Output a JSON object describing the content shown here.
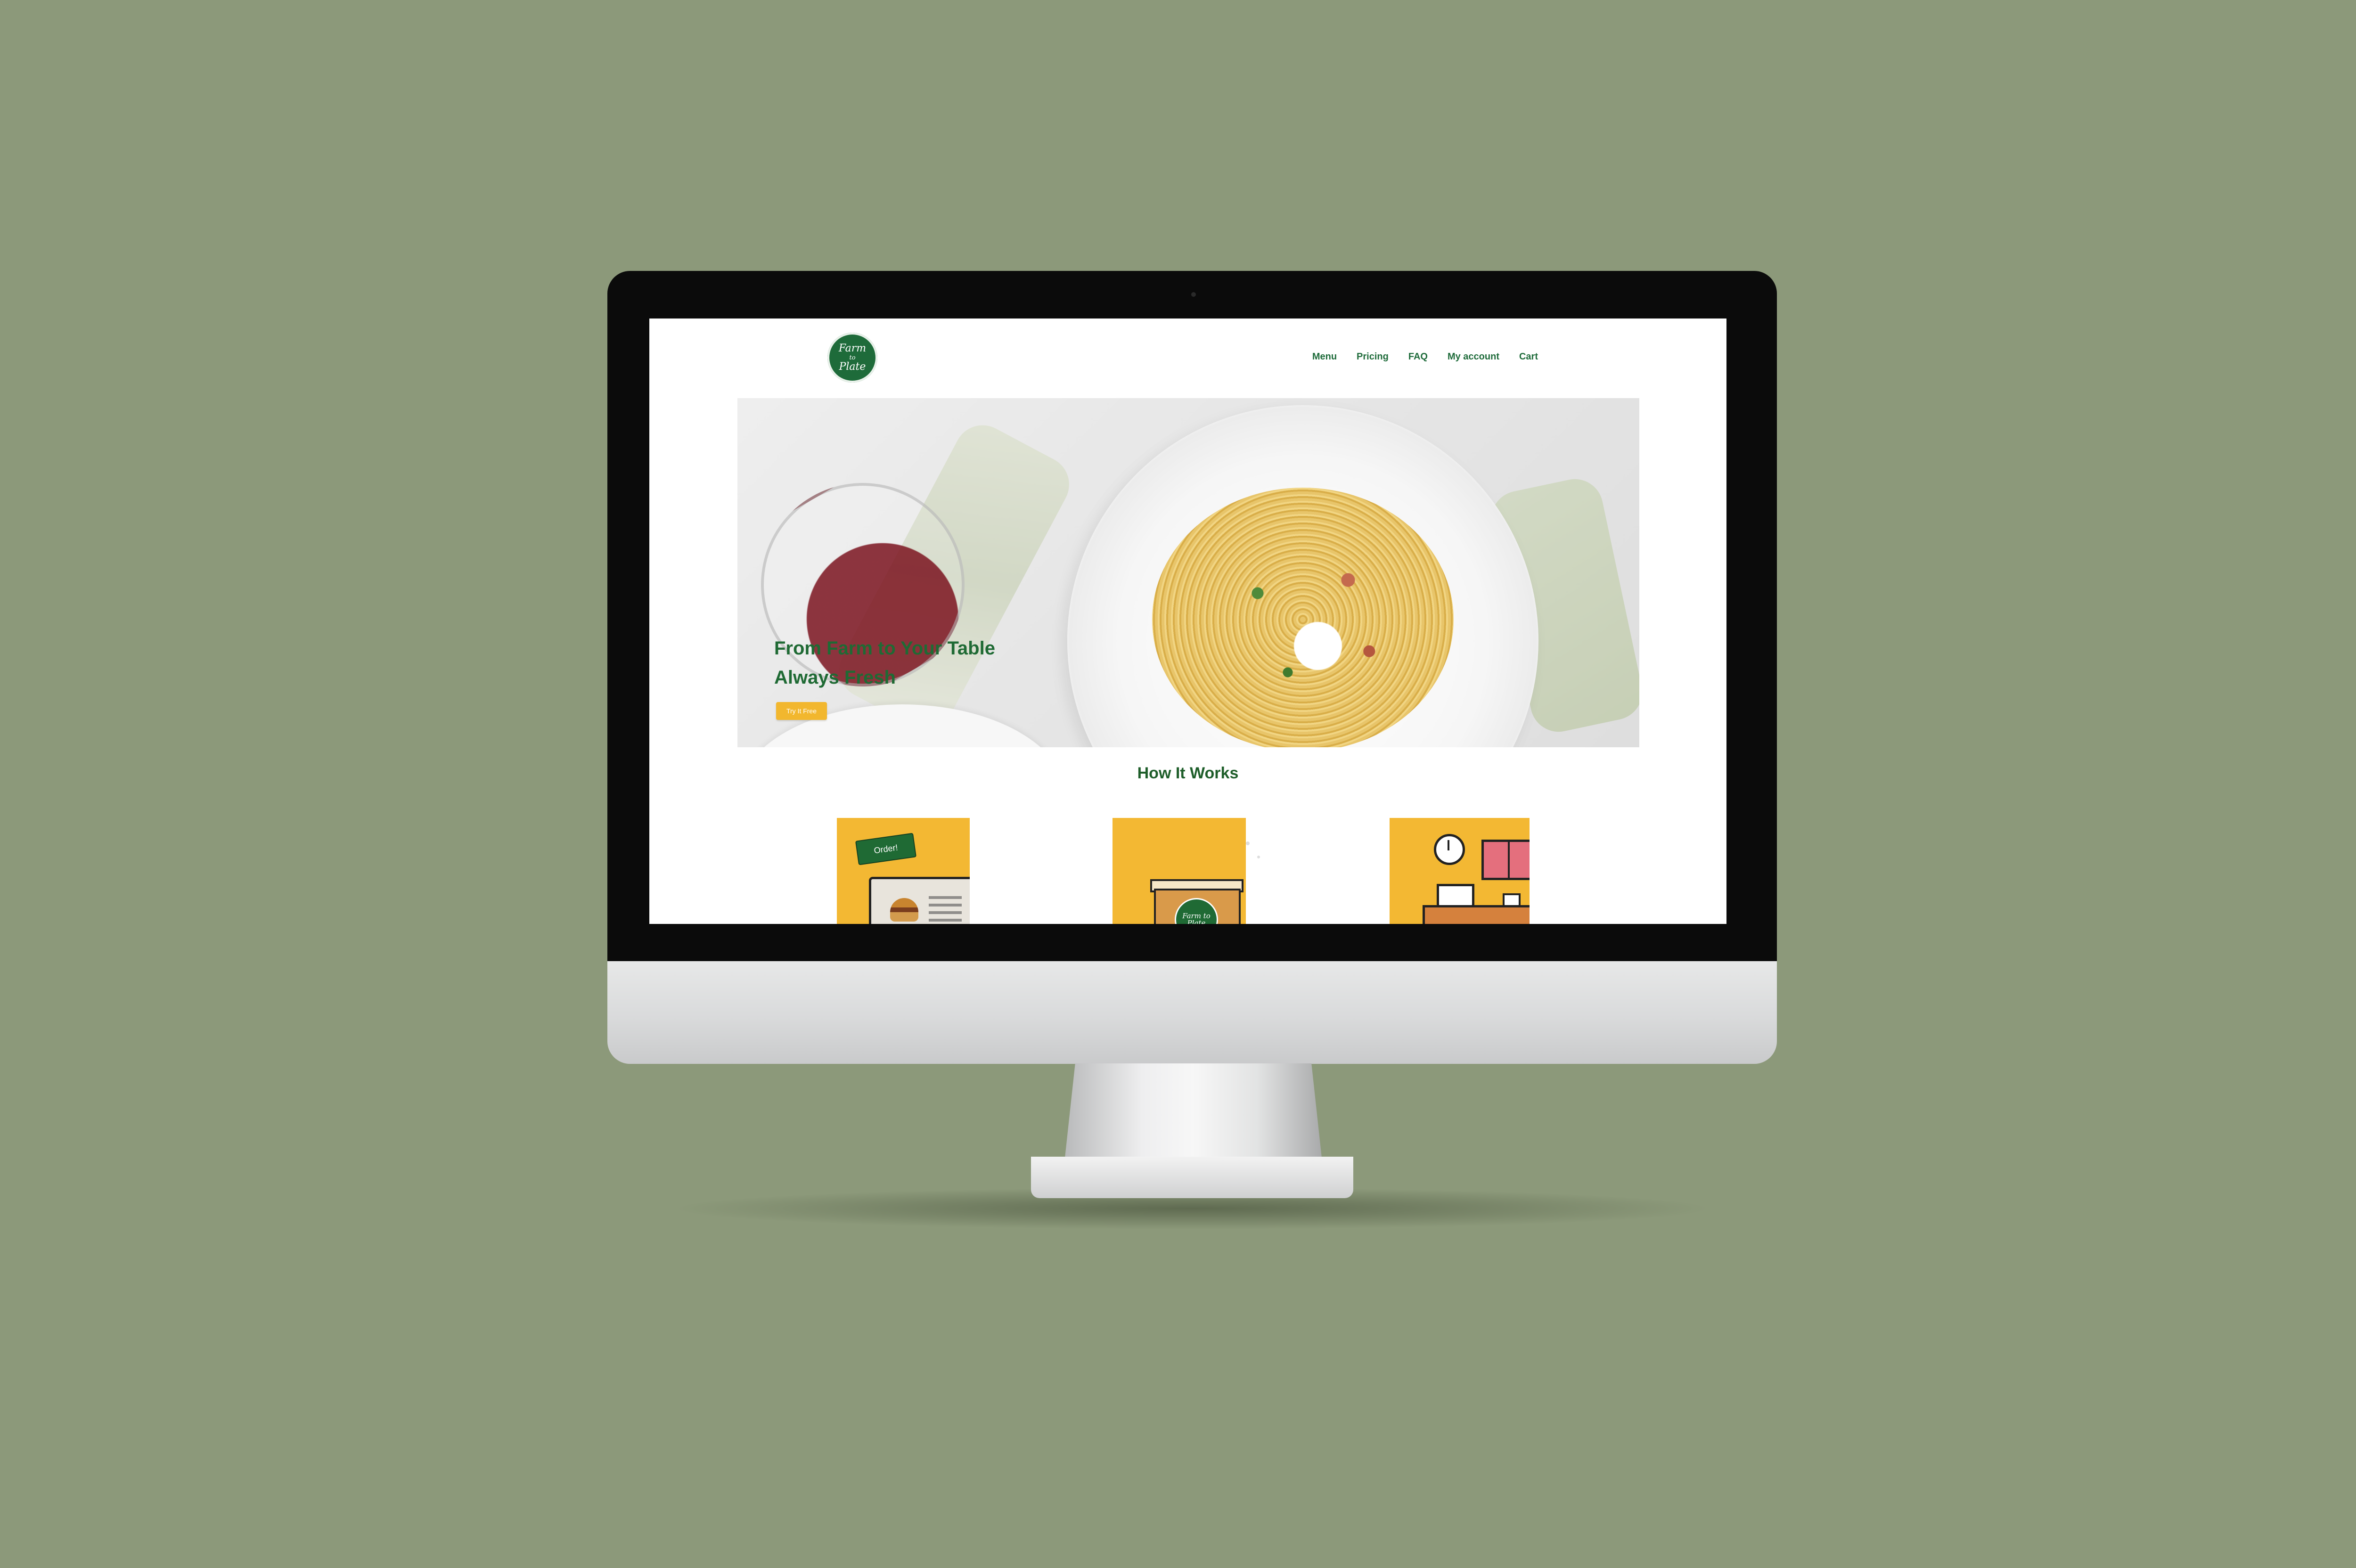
{
  "brand": {
    "logo_line1": "Farm",
    "logo_line2": "to",
    "logo_line3": "Plate"
  },
  "nav": {
    "items": [
      "Menu",
      "Pricing",
      "FAQ",
      "My account",
      "Cart"
    ]
  },
  "hero": {
    "title_line1": "From Farm to Your Table",
    "title_line2": "Always Fresh",
    "cta_label": "Try It Free"
  },
  "how_it_works": {
    "title": "How It Works",
    "step1_tag": "Order!",
    "step2_box_logo": "Farm to Plate"
  },
  "colors": {
    "background": "#8c997a",
    "brand_green": "#1f6a34",
    "accent_yellow": "#f3b833"
  }
}
